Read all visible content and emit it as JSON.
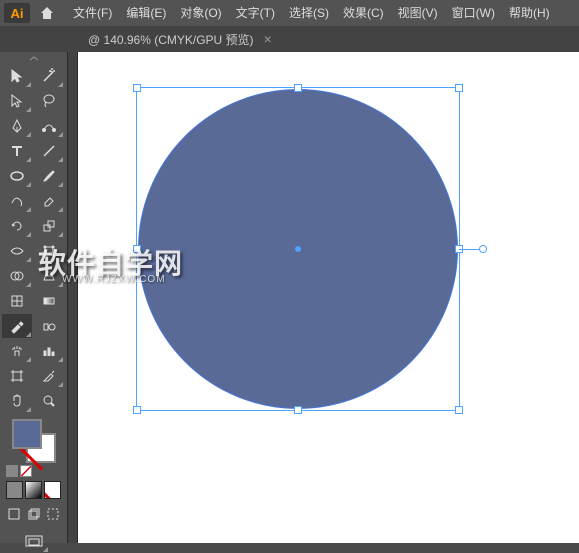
{
  "app": {
    "logo": "Ai"
  },
  "menu": {
    "items": [
      "文件(F)",
      "编辑(E)",
      "对象(O)",
      "文字(T)",
      "选择(S)",
      "效果(C)",
      "视图(V)",
      "窗口(W)",
      "帮助(H)"
    ]
  },
  "tab": {
    "title": "@ 140.96%  (CMYK/GPU 预览)",
    "close": "×"
  },
  "tools": [
    "selection",
    "direct-selection",
    "magic-wand",
    "lasso",
    "pen",
    "curvature",
    "type",
    "line",
    "rectangle",
    "paintbrush",
    "shaper",
    "eraser",
    "rotate",
    "scale",
    "width",
    "free-transform",
    "shape-builder",
    "perspective",
    "mesh",
    "gradient",
    "eyedropper",
    "blend",
    "symbol-sprayer",
    "column-graph",
    "artboard",
    "slice",
    "hand",
    "zoom"
  ],
  "watermark": {
    "main": "软件自学网",
    "sub": "WWW.RJZXW.COM"
  },
  "colors": {
    "fill": "#5a6a97"
  }
}
